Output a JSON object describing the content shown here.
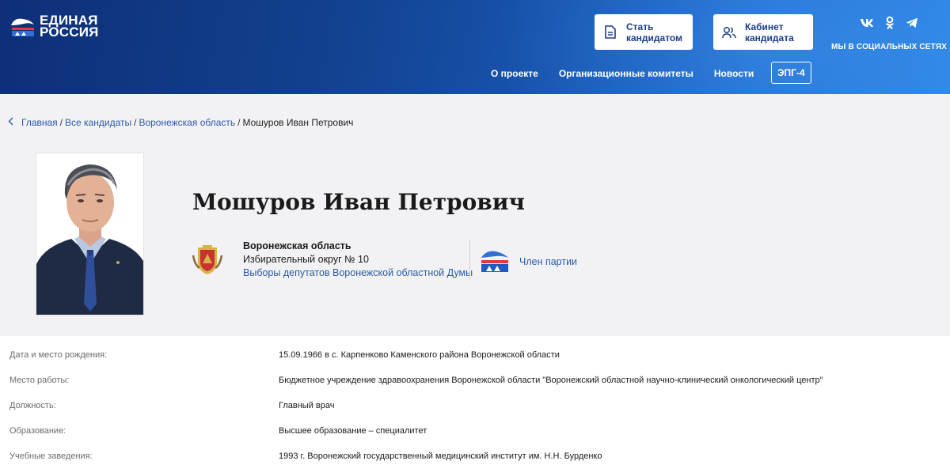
{
  "header": {
    "logo": {
      "line1": "ЕДИНАЯ",
      "line2": "РОССИЯ"
    },
    "buttons": {
      "candidate": {
        "line1": "Стать",
        "line2": "кандидатом",
        "icon": "document-icon"
      },
      "cabinet": {
        "line1": "Кабинет",
        "line2": "кандидата",
        "icon": "users-icon"
      }
    },
    "social": {
      "label": "МЫ В СОЦИАЛЬНЫХ СЕТЯХ",
      "icons": [
        "vk-icon",
        "ok-icon",
        "telegram-icon"
      ]
    },
    "nav": {
      "about": "О проекте",
      "committees": "Организационные комитеты",
      "news": "Новости",
      "epg": "ЭПГ-4"
    }
  },
  "breadcrumb": {
    "home": "Главная",
    "all": "Все кандидаты",
    "region": "Воронежская область",
    "current": "Мошуров Иван Петрович"
  },
  "profile": {
    "name": "Мошуров Иван Петрович",
    "region_name": "Воронежская область",
    "district": "Избирательный округ № 10",
    "election": "Выборы депутатов Воронежской областной Думы",
    "membership": "Член партии"
  },
  "details": [
    {
      "label": "Дата и место рождения:",
      "value": "15.09.1966 в с. Карпенково Каменского района Воронежской области"
    },
    {
      "label": "Место работы:",
      "value": "Бюджетное учреждение здравоохранения Воронежской области \"Воронежский областной научно-клинический онкологический центр\""
    },
    {
      "label": "Должность:",
      "value": "Главный врач"
    },
    {
      "label": "Образование:",
      "value": "Высшее образование – специалитет"
    },
    {
      "label": "Учебные заведения:",
      "value": "1993 г. Воронежский государственный медицинский институт им. Н.Н. Бурденко"
    }
  ],
  "colors": {
    "header_dark": "#0e2f78",
    "header_light": "#2f86e6",
    "link": "#2a5aa8",
    "panel": "#f2f2f4"
  }
}
